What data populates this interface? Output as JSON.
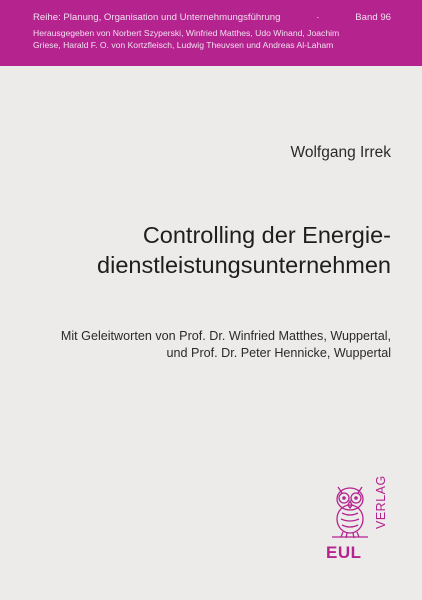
{
  "series": {
    "name": "Reihe: Planung, Organisation und Unternehmungsführung",
    "separator": "·",
    "volume": "Band 96"
  },
  "editors": {
    "line1": "Herausgegeben von Norbert Szyperski, Winfried Matthes, Udo Winand, Joachim",
    "line2": "Griese, Harald F. O. von Kortzfleisch, Ludwig Theuvsen und Andreas Al-Laham"
  },
  "author": "Wolfgang Irrek",
  "title": {
    "line1": "Controlling der Energie-",
    "line2": "dienstleistungsunternehmen"
  },
  "forewords": {
    "line1": "Mit Geleitworten von Prof. Dr. Winfried Matthes, Wuppertal,",
    "line2": "und Prof. Dr. Peter Hennicke, Wuppertal"
  },
  "publisher": {
    "name": "EUL",
    "verlag": "VERLAG",
    "brand_color": "#b5238f"
  },
  "colors": {
    "band": "#b5238f",
    "background": "#ecebea",
    "text": "#222222"
  },
  "icons": {
    "logo": "owl-icon"
  }
}
